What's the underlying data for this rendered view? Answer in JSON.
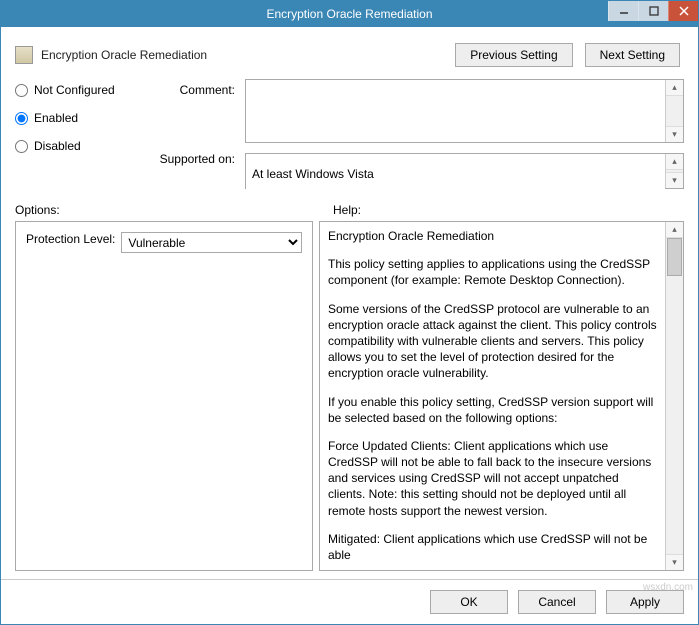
{
  "window": {
    "title": "Encryption Oracle Remediation"
  },
  "header": {
    "policy_title": "Encryption Oracle Remediation",
    "prev_btn": "Previous Setting",
    "next_btn": "Next Setting"
  },
  "state": {
    "options": [
      "Not Configured",
      "Enabled",
      "Disabled"
    ],
    "selected": "Enabled"
  },
  "labels": {
    "comment": "Comment:",
    "supported_on": "Supported on:",
    "options": "Options:",
    "help": "Help:",
    "protection_level": "Protection Level:"
  },
  "fields": {
    "comment": "",
    "supported_on": "At least Windows Vista",
    "protection_level_value": "Vulnerable"
  },
  "help": {
    "title": "Encryption Oracle Remediation",
    "p1": "This policy setting applies to applications using the CredSSP component (for example: Remote Desktop Connection).",
    "p2": "Some versions of the CredSSP protocol are vulnerable to an encryption oracle attack against the client.  This policy controls compatibility with vulnerable clients and servers.  This policy allows you to set the level of protection desired for the encryption oracle vulnerability.",
    "p3": "If you enable this policy setting, CredSSP version support will be selected based on the following options:",
    "p4": "Force Updated Clients: Client applications which use CredSSP will not be able to fall back to the insecure versions and services using CredSSP will not accept unpatched clients. Note: this setting should not be deployed until all remote hosts support the newest version.",
    "p5": "Mitigated: Client applications which use CredSSP will not be able"
  },
  "footer": {
    "ok": "OK",
    "cancel": "Cancel",
    "apply": "Apply"
  },
  "watermark": "wsxdn.com"
}
